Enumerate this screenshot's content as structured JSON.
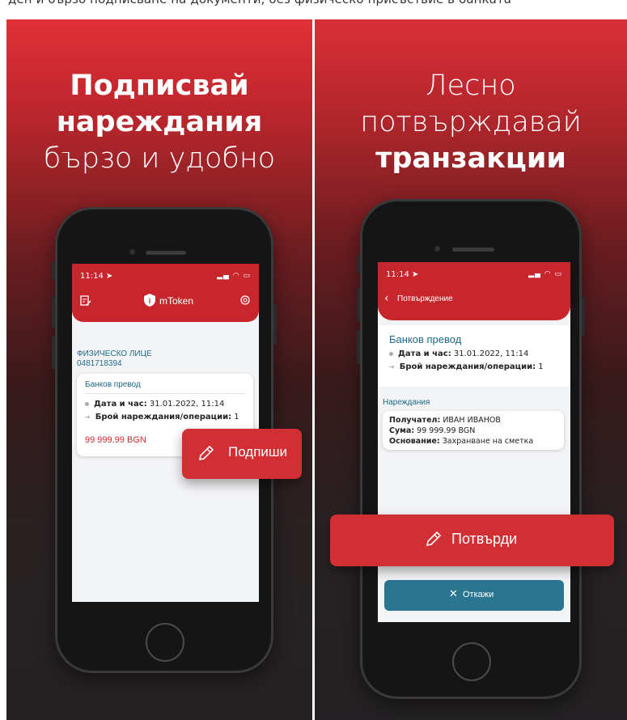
{
  "top_text": "ден и бързо подписване на документи, без физическо присъствие в банката",
  "left": {
    "headline_bold_1": "Подписвай",
    "headline_bold_2": "нареждания",
    "headline_light": "бързо и удобно",
    "status_time": "11:14",
    "app_title": "mToken",
    "account_type": "ФИЗИЧЕСКО ЛИЦЕ",
    "account_number": "0481718394",
    "card_title": "Банков превод",
    "datetime_label": "Дата и час:",
    "datetime_value": "31.01.2022, 11:14",
    "count_label": "Брой нареждания/операции:",
    "count_value": "1",
    "amount": "99 999.99 BGN",
    "sign_button": "Подпиши"
  },
  "right": {
    "headline_light_1": "Лесно",
    "headline_light_2": "потвърждавай",
    "headline_bold": "транзакции",
    "status_time": "11:14",
    "nav_title": "Потвърждение",
    "card_title": "Банков превод",
    "datetime_label": "Дата и час:",
    "datetime_value": "31.01.2022, 11:14",
    "count_label": "Брой нареждания/операции:",
    "count_value": "1",
    "section_title": "Нареждания",
    "recipient_label": "Получател:",
    "recipient_value": "ИВАН ИВАНОВ",
    "sum_label": "Сума:",
    "sum_value": "99 999.99 BGN",
    "basis_label": "Основание:",
    "basis_value": "Захранване на сметка",
    "confirm_button": "Потвърди",
    "cancel_button": "Откажи"
  },
  "colors": {
    "brand_red": "#c8262d",
    "teal_button": "#2a7590",
    "blue_text": "#1f6a8a"
  }
}
